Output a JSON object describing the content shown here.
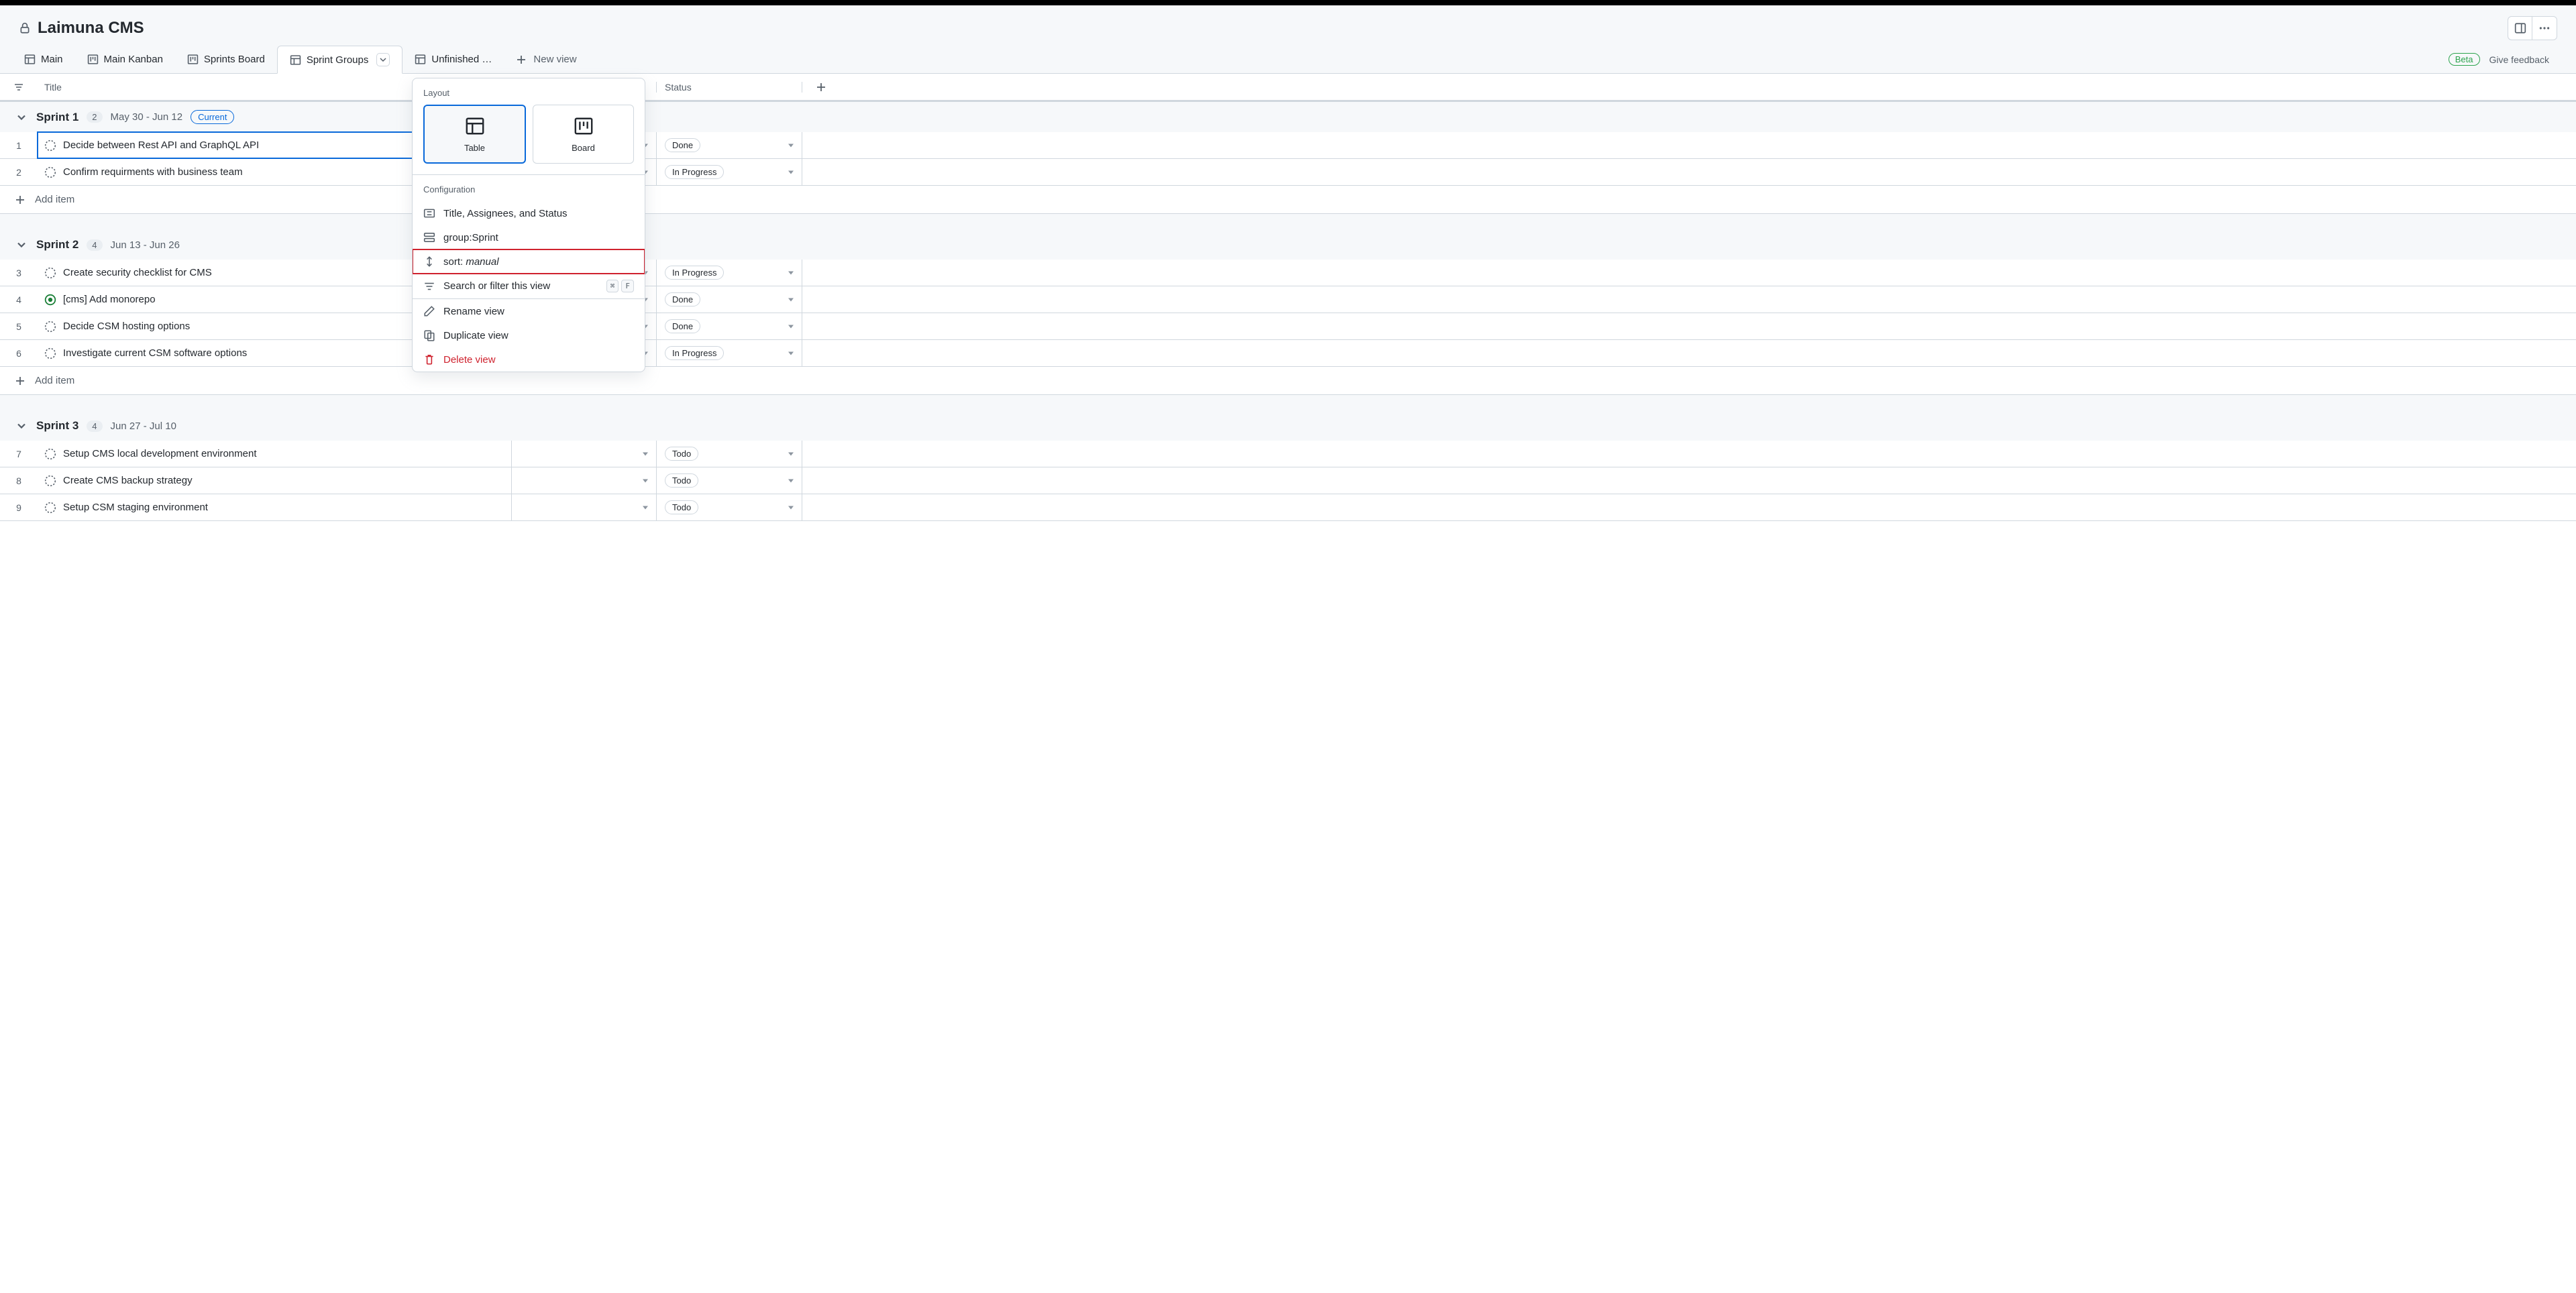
{
  "project": {
    "title": "Laimuna CMS"
  },
  "tabs": [
    {
      "label": "Main",
      "icon": "table"
    },
    {
      "label": "Main Kanban",
      "icon": "board"
    },
    {
      "label": "Sprints Board",
      "icon": "board"
    },
    {
      "label": "Sprint Groups",
      "icon": "table",
      "active": true,
      "has_dropdown": true
    },
    {
      "label": "Unfinished …",
      "icon": "table"
    }
  ],
  "new_view_label": "New view",
  "beta_label": "Beta",
  "feedback_label": "Give feedback",
  "columns": {
    "title": "Title",
    "status": "Status"
  },
  "groups": [
    {
      "name": "Sprint 1",
      "count": "2",
      "dates": "May 30 - Jun 12",
      "current": true,
      "rows": [
        {
          "num": "1",
          "icon": "draft",
          "title": "Decide between Rest API and GraphQL API",
          "status": "Done",
          "selected": true
        },
        {
          "num": "2",
          "icon": "draft",
          "title": "Confirm requirments with business team",
          "status": "In Progress"
        }
      ]
    },
    {
      "name": "Sprint 2",
      "count": "4",
      "dates": "Jun 13 - Jun 26",
      "rows": [
        {
          "num": "3",
          "icon": "draft",
          "title": "Create security checklist for CMS",
          "status": "In Progress"
        },
        {
          "num": "4",
          "icon": "open",
          "title": "[cms] Add monorepo",
          "status": "Done"
        },
        {
          "num": "5",
          "icon": "draft",
          "title": "Decide CSM hosting options",
          "status": "Done"
        },
        {
          "num": "6",
          "icon": "draft",
          "title": "Investigate current CSM software options",
          "status": "In Progress"
        }
      ]
    },
    {
      "name": "Sprint 3",
      "count": "4",
      "dates": "Jun 27 - Jul 10",
      "rows": [
        {
          "num": "7",
          "icon": "draft",
          "title": "Setup CMS local development environment",
          "status": "Todo"
        },
        {
          "num": "8",
          "icon": "draft",
          "title": "Create CMS backup strategy",
          "status": "Todo"
        },
        {
          "num": "9",
          "icon": "draft",
          "title": "Setup CSM staging environment",
          "status": "Todo"
        }
      ]
    }
  ],
  "add_item": "Add item",
  "current_label": "Current",
  "popover": {
    "layout_label": "Layout",
    "layouts": {
      "table": "Table",
      "board": "Board"
    },
    "config_label": "Configuration",
    "fields": "Title, Assignees, and Status",
    "group_prefix": "group:",
    "group_value": "Sprint",
    "sort_prefix": "sort: ",
    "sort_value": "manual",
    "search": "Search or filter this view",
    "kbd1": "⌘",
    "kbd2": "F",
    "rename": "Rename view",
    "duplicate": "Duplicate view",
    "delete": "Delete view"
  }
}
